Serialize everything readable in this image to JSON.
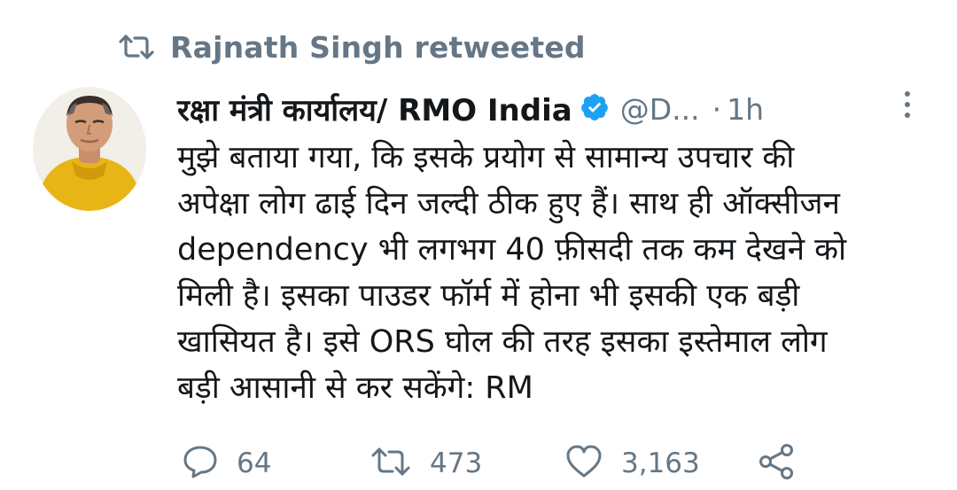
{
  "retweet_notice": {
    "icon": "retweet-icon",
    "text": "Rajnath Singh retweeted"
  },
  "tweet": {
    "author": {
      "display_name": "रक्षा मंत्री कार्यालय/ RMO India",
      "verified": true,
      "verified_color": "#1da1f2",
      "handle": "@D...",
      "separator": "·",
      "time": "1h"
    },
    "body": "मुझे बताया गया, कि इसके प्रयोग से सामान्य उपचार की\nअपेक्षा लोग ढाई दिन जल्दी ठीक हुए हैं। साथ ही ऑक्सीजन\ndependency भी लगभग 40 फ़ीसदी तक कम देखने को\nमिली है। इसका पाउडर फॉर्म में होना भी इसकी एक बड़ी\nखासियत है। इसे ORS घोल की तरह इसका इस्तेमाल लोग\nबड़ी आसानी से कर सकेंगे: RM",
    "actions": {
      "reply_count": "64",
      "retweet_count": "473",
      "like_count": "3,163"
    }
  },
  "colors": {
    "text_primary": "#14171a",
    "text_secondary": "#657786",
    "background": "#ffffff",
    "verified_blue": "#1da1f2"
  }
}
